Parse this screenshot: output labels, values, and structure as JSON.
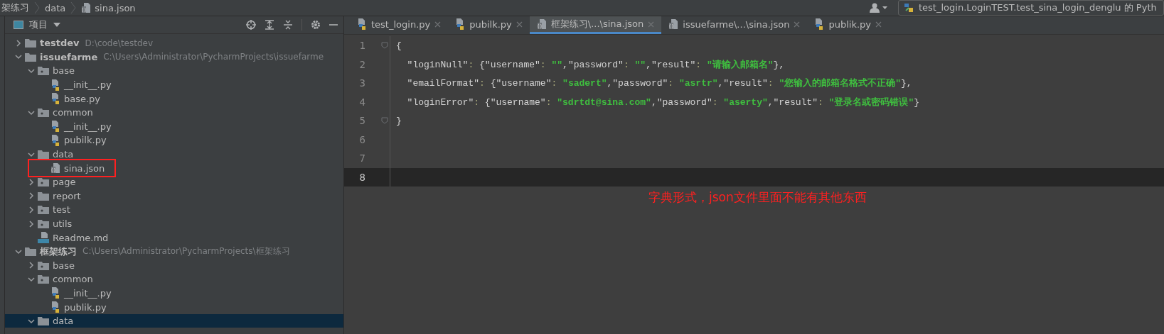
{
  "breadcrumb": [
    {
      "label": "架练习",
      "kind": "folder"
    },
    {
      "label": "data",
      "kind": "folder"
    },
    {
      "label": "sina.json",
      "kind": "json"
    }
  ],
  "run_config": {
    "label": "test_login.LoginTEST.test_sina_login_denglu 的 Pyth"
  },
  "project_panel": {
    "title": "项目"
  },
  "tree": [
    {
      "name": "testdev",
      "path": "D:\\code\\testdev",
      "kind": "project",
      "expanded": false,
      "selected": false,
      "boxed": false
    },
    {
      "name": "issuefarme",
      "path": "C:\\Users\\Administrator\\PycharmProjects\\issuefarme",
      "kind": "project",
      "expanded": true,
      "selected": false,
      "boxed": false,
      "children": [
        {
          "name": "base",
          "kind": "package",
          "expanded": true,
          "selected": false,
          "boxed": false,
          "children": [
            {
              "name": "__init__.py",
              "kind": "py",
              "selected": false,
              "boxed": false
            },
            {
              "name": "base.py",
              "kind": "py",
              "selected": false,
              "boxed": false
            }
          ]
        },
        {
          "name": "common",
          "kind": "package",
          "expanded": true,
          "selected": false,
          "boxed": false,
          "children": [
            {
              "name": "__init__.py",
              "kind": "py",
              "selected": false,
              "boxed": false
            },
            {
              "name": "pubilk.py",
              "kind": "py",
              "selected": false,
              "boxed": false
            }
          ]
        },
        {
          "name": "data",
          "kind": "folder",
          "expanded": true,
          "selected": false,
          "boxed": false,
          "children": [
            {
              "name": "sina.json",
              "kind": "json",
              "selected": false,
              "boxed": true
            }
          ]
        },
        {
          "name": "page",
          "kind": "package",
          "expanded": false,
          "selected": false,
          "boxed": false
        },
        {
          "name": "report",
          "kind": "folder",
          "expanded": false,
          "selected": false,
          "boxed": false
        },
        {
          "name": "test",
          "kind": "package",
          "expanded": false,
          "selected": false,
          "boxed": false
        },
        {
          "name": "utils",
          "kind": "package",
          "expanded": false,
          "selected": false,
          "boxed": false
        },
        {
          "name": "Readme.md",
          "kind": "md",
          "selected": false,
          "boxed": false
        }
      ]
    },
    {
      "name": "框架练习",
      "path": "C:\\Users\\Administrator\\PycharmProjects\\框架练习",
      "kind": "project",
      "expanded": true,
      "selected": false,
      "boxed": false,
      "children": [
        {
          "name": "base",
          "kind": "package",
          "expanded": false,
          "selected": false,
          "boxed": false
        },
        {
          "name": "common",
          "kind": "package",
          "expanded": true,
          "selected": false,
          "boxed": false,
          "children": [
            {
              "name": "__init__.py",
              "kind": "py",
              "selected": false,
              "boxed": false
            },
            {
              "name": "publik.py",
              "kind": "py",
              "selected": false,
              "boxed": false
            }
          ]
        },
        {
          "name": "data",
          "kind": "folder",
          "expanded": true,
          "selected": true,
          "boxed": false
        }
      ]
    }
  ],
  "tabs": [
    {
      "label": "test_login.py",
      "kind": "py",
      "selected": false
    },
    {
      "label": "pubilk.py",
      "kind": "py",
      "selected": false
    },
    {
      "label": "框架练习\\...\\sina.json",
      "kind": "json",
      "selected": true
    },
    {
      "label": "issuefarme\\...\\sina.json",
      "kind": "json",
      "selected": false
    },
    {
      "label": "publik.py",
      "kind": "py",
      "selected": false
    }
  ],
  "code_lines": [
    {
      "number": "1",
      "fold_marker": true,
      "current": false,
      "tokens": [
        {
          "kind": "punct",
          "text": "{"
        }
      ]
    },
    {
      "number": "2",
      "fold_marker": false,
      "current": false,
      "tokens": [
        {
          "kind": "key",
          "text": "  \"loginNull\""
        },
        {
          "kind": "colon",
          "text": ": "
        },
        {
          "kind": "punct",
          "text": "{"
        },
        {
          "kind": "key",
          "text": "\"username\""
        },
        {
          "kind": "colon",
          "text": ": "
        },
        {
          "kind": "str",
          "text": "\"\""
        },
        {
          "kind": "punct",
          "text": ","
        },
        {
          "kind": "key",
          "text": "\"password\""
        },
        {
          "kind": "colon",
          "text": ": "
        },
        {
          "kind": "str",
          "text": "\"\""
        },
        {
          "kind": "punct",
          "text": ","
        },
        {
          "kind": "key",
          "text": "\"result\""
        },
        {
          "kind": "colon",
          "text": ": "
        },
        {
          "kind": "str",
          "text": "\"请输入邮箱名\""
        },
        {
          "kind": "punct",
          "text": "},"
        }
      ]
    },
    {
      "number": "3",
      "fold_marker": false,
      "current": false,
      "tokens": [
        {
          "kind": "key",
          "text": "  \"emailFormat\""
        },
        {
          "kind": "colon",
          "text": ": "
        },
        {
          "kind": "punct",
          "text": "{"
        },
        {
          "kind": "key",
          "text": "\"username\""
        },
        {
          "kind": "colon",
          "text": ": "
        },
        {
          "kind": "str",
          "text": "\"sadert\""
        },
        {
          "kind": "punct",
          "text": ","
        },
        {
          "kind": "key",
          "text": "\"password\""
        },
        {
          "kind": "colon",
          "text": ": "
        },
        {
          "kind": "str",
          "text": "\"asrtr\""
        },
        {
          "kind": "punct",
          "text": ","
        },
        {
          "kind": "key",
          "text": "\"result\""
        },
        {
          "kind": "colon",
          "text": ": "
        },
        {
          "kind": "str",
          "text": "\"您输入的邮箱名格式不正确\""
        },
        {
          "kind": "punct",
          "text": "},"
        }
      ]
    },
    {
      "number": "4",
      "fold_marker": false,
      "current": false,
      "tokens": [
        {
          "kind": "key",
          "text": "  \"loginError\""
        },
        {
          "kind": "colon",
          "text": ": "
        },
        {
          "kind": "punct",
          "text": "{"
        },
        {
          "kind": "key",
          "text": "\"username\""
        },
        {
          "kind": "colon",
          "text": ": "
        },
        {
          "kind": "str",
          "text": "\"sdrtdt@sina.com\""
        },
        {
          "kind": "punct",
          "text": ","
        },
        {
          "kind": "key",
          "text": "\"password\""
        },
        {
          "kind": "colon",
          "text": ": "
        },
        {
          "kind": "str",
          "text": "\"aserty\""
        },
        {
          "kind": "punct",
          "text": ","
        },
        {
          "kind": "key",
          "text": "\"result\""
        },
        {
          "kind": "colon",
          "text": ": "
        },
        {
          "kind": "str",
          "text": "\"登录名或密码错误\""
        },
        {
          "kind": "punct",
          "text": "}"
        }
      ]
    },
    {
      "number": "5",
      "fold_marker": true,
      "current": false,
      "tokens": [
        {
          "kind": "punct",
          "text": "}"
        }
      ]
    },
    {
      "number": "6",
      "fold_marker": false,
      "current": false
    },
    {
      "number": "7",
      "fold_marker": false,
      "current": false
    },
    {
      "number": "8",
      "fold_marker": false,
      "current": true
    }
  ],
  "annotation": {
    "text": "字典形式，json文件里面不能有其他东西"
  }
}
